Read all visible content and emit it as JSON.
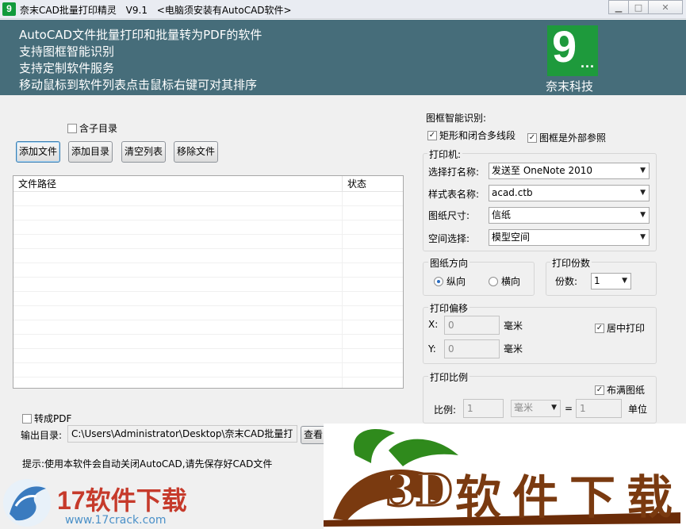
{
  "window": {
    "app_name": "奈末CAD批量打印精灵",
    "version": "V9.1",
    "notice": "<电脑须安装有AutoCAD软件>",
    "app_icon_letter": "9",
    "minimize_label": "",
    "maximize_label": "□",
    "close_label": "✕"
  },
  "banner": {
    "lines": [
      "AutoCAD文件批量打印和批量转为PDF的软件",
      "支持图框智能识别",
      "支持定制软件服务",
      "移动鼠标到软件列表点击鼠标右键可对其排序"
    ],
    "logo_digit": "9",
    "logo_dots": "...",
    "logo_caption": "奈末科技",
    "bg_color": "#466d7a",
    "logo_color": "#1e9a3c"
  },
  "left": {
    "include_subdirs_label": "含子目录",
    "include_subdirs_checked": false,
    "buttons": {
      "add_file": "添加文件",
      "add_folder": "添加目录",
      "clear_list": "清空列表",
      "remove_file": "移除文件"
    },
    "list": {
      "columns": [
        "文件路径",
        "状态"
      ],
      "rows": []
    },
    "to_pdf_label": "转成PDF",
    "to_pdf_checked": false,
    "output_dir_label": "输出目录:",
    "output_dir_value": "C:\\Users\\Administrator\\Desktop\\奈末CAD批量打图精",
    "browse_button": "查看",
    "tip": "提示:使用本软件会自动关闭AutoCAD,请先保存好CAD文件"
  },
  "right": {
    "frame_detect_title": "图框智能识别:",
    "rect_polyline_label": "矩形和闭合多线段",
    "rect_polyline_checked": true,
    "frame_xref_label": "图框是外部参照",
    "frame_xref_checked": true,
    "printer": {
      "title": "打印机:",
      "printer_name_label": "选择打名称:",
      "printer_name_value": "发送至 OneNote 2010",
      "style_label": "样式表名称:",
      "style_value": "acad.ctb",
      "paper_label": "图纸尺寸:",
      "paper_value": "信纸",
      "space_label": "空间选择:",
      "space_value": "模型空间"
    },
    "orientation": {
      "title": "图纸方向",
      "portrait": "纵向",
      "landscape": "横向",
      "selected": "纵向"
    },
    "copies": {
      "title": "打印份数",
      "label": "份数:",
      "value": "1"
    },
    "offset": {
      "title": "打印偏移",
      "x_label": "X:",
      "x_value": "0",
      "y_label": "Y:",
      "y_value": "0",
      "unit": "毫米",
      "center_label": "居中打印",
      "center_checked": true
    },
    "scale": {
      "title": "打印比例",
      "fit_label": "布满图纸",
      "fit_checked": true,
      "scale_label": "比例:",
      "left_value": "1",
      "unit_value": "毫米",
      "equals": "=",
      "right_value": "1",
      "unit_label": "单位"
    }
  },
  "watermarks": {
    "site_name": "17软件下载",
    "site_url": "www.17crack.com",
    "brand_3d": "3D",
    "brand_text": "软件下载"
  }
}
